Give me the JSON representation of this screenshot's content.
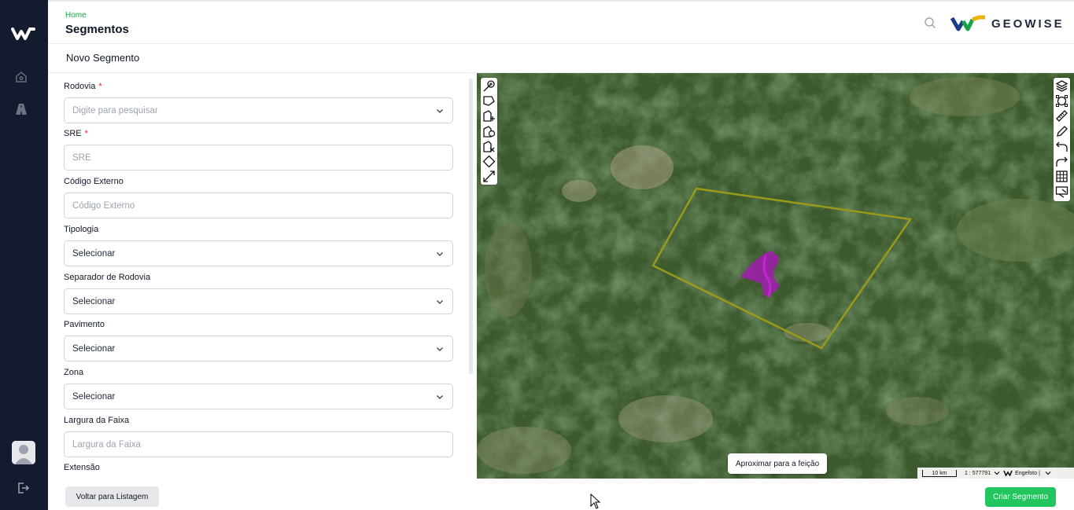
{
  "header": {
    "breadcrumb": "Home",
    "title": "Segmentos",
    "brand_name": "GEOWISE"
  },
  "subheader": {
    "title": "Novo Segmento"
  },
  "form": {
    "fields": [
      {
        "label": "Rodovia",
        "required": true,
        "type": "select",
        "text": "Digite para pesquisar",
        "is_placeholder": true
      },
      {
        "label": "SRE",
        "required": true,
        "type": "input",
        "text": "SRE",
        "is_placeholder": true
      },
      {
        "label": "Código Externo",
        "required": false,
        "type": "input",
        "text": "Código Externo",
        "is_placeholder": true
      },
      {
        "label": "Tipologia",
        "required": false,
        "type": "select",
        "text": "Selecionar",
        "is_placeholder": false
      },
      {
        "label": "Separador de Rodovia",
        "required": false,
        "type": "select",
        "text": "Selecionar",
        "is_placeholder": false
      },
      {
        "label": "Pavimento",
        "required": false,
        "type": "select",
        "text": "Selecionar",
        "is_placeholder": false
      },
      {
        "label": "Zona",
        "required": false,
        "type": "select",
        "text": "Selecionar",
        "is_placeholder": false
      },
      {
        "label": "Largura da Faixa",
        "required": false,
        "type": "input",
        "text": "Largura da Faixa",
        "is_placeholder": true
      },
      {
        "label": "Extensão",
        "required": false,
        "type": "input",
        "text": "",
        "is_placeholder": true
      }
    ]
  },
  "map": {
    "zoom_to_feature_label": "Aproximar para a feição",
    "scale_label": "10 km",
    "scale_ratio": "1 : 577791",
    "attribution": "Engefoto |",
    "left_tools": [
      "draw-point-icon",
      "draw-polygon-icon",
      "add-polygon-icon",
      "edit-polygon-icon",
      "cut-polygon-icon",
      "draw-rectangle-icon",
      "draw-line-icon"
    ],
    "right_tools": [
      "layers-icon",
      "transform-icon",
      "measure-icon",
      "pencil-icon",
      "undo-icon",
      "redo-icon",
      "grid-icon",
      "legend-icon"
    ]
  },
  "footer": {
    "back_label": "Voltar para Listagem",
    "create_label": "Criar Segmento"
  },
  "colors": {
    "sidebar": "#151b2e",
    "accent_green": "#22c55e",
    "required": "#dc2626",
    "polygon_outline": "#9a9a1a",
    "feature": "#a21caf"
  }
}
